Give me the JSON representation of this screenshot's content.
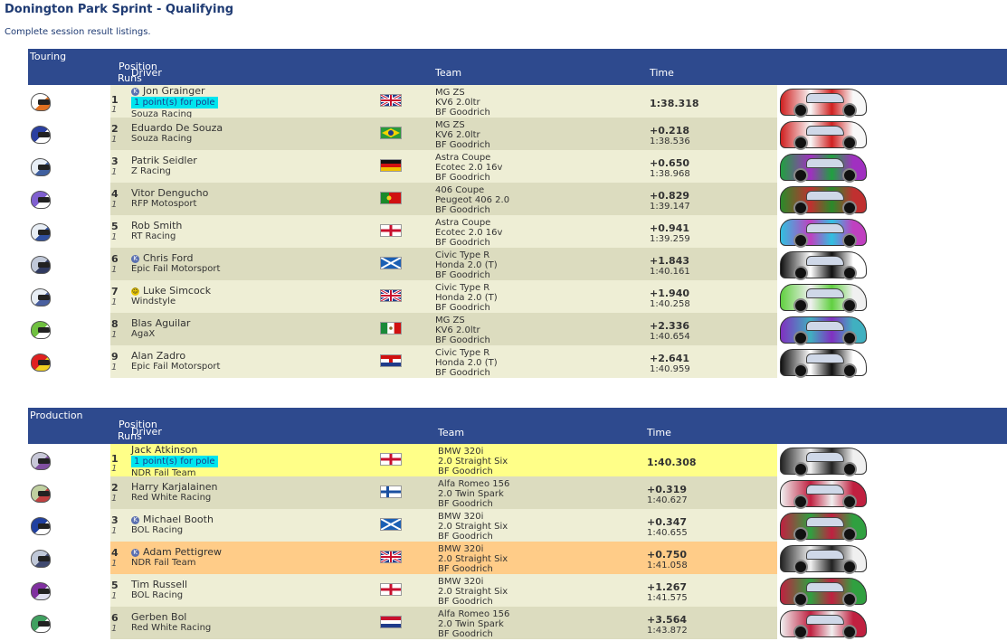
{
  "page": {
    "title": "Donington Park Sprint - Qualifying",
    "subtitle": "Complete session result listings."
  },
  "columns": {
    "position": "Position",
    "runs": "Runs",
    "driver": "Driver",
    "team": "Team",
    "time": "Time"
  },
  "sections": [
    {
      "class_name": "Touring",
      "rows": [
        {
          "pos": "1",
          "runs": "1",
          "driver": "Jon Grainger",
          "license": "K",
          "note": "1 point(s) for pole",
          "team_name": "Souza Racing",
          "car": "MG ZS",
          "engine": "KV6 2.0ltr",
          "tyres": "BF Goodrich",
          "gap": "1:38.318",
          "time": "",
          "flag": "uk",
          "helmet": "#ffffff",
          "helmet2": "#e07020",
          "car_color": "#d02020",
          "car_color2": "#f8f8f8"
        },
        {
          "pos": "2",
          "runs": "1",
          "driver": "Eduardo De Souza",
          "license": "",
          "note": "",
          "team_name": "Souza Racing",
          "car": "MG ZS",
          "engine": "KV6 2.0ltr",
          "tyres": "BF Goodrich",
          "gap": "+0.218",
          "time": "1:38.536",
          "flag": "brazil",
          "helmet": "#2a3fa0",
          "helmet2": "#ffffff",
          "car_color": "#d02020",
          "car_color2": "#f8f8f8"
        },
        {
          "pos": "3",
          "runs": "1",
          "driver": "Patrik Seidler",
          "license": "",
          "note": "",
          "team_name": "Z Racing",
          "car": "Astra Coupe",
          "engine": "Ecotec 2.0 16v",
          "tyres": "BF Goodrich",
          "gap": "+0.650",
          "time": "1:38.968",
          "flag": "germany",
          "helmet": "#e8eef5",
          "helmet2": "#4060a0",
          "car_color": "#20a040",
          "car_color2": "#a030c0"
        },
        {
          "pos": "4",
          "runs": "1",
          "driver": "Vitor Dengucho",
          "license": "",
          "note": "",
          "team_name": "RFP Motosport",
          "car": "406 Coupe",
          "engine": "Peugeot 406 2.0",
          "tyres": "BF Goodrich",
          "gap": "+0.829",
          "time": "1:39.147",
          "flag": "portugal",
          "helmet": "#8060d0",
          "helmet2": "#ffffff",
          "car_color": "#2a8a2a",
          "car_color2": "#c03030"
        },
        {
          "pos": "5",
          "runs": "1",
          "driver": "Rob Smith",
          "license": "",
          "note": "",
          "team_name": "RT Racing",
          "car": "Astra Coupe",
          "engine": "Ecotec 2.0 16v",
          "tyres": "BF Goodrich",
          "gap": "+0.941",
          "time": "1:39.259",
          "flag": "england",
          "helmet": "#e8eef5",
          "helmet2": "#3050a0",
          "car_color": "#30c0e0",
          "car_color2": "#c040c0"
        },
        {
          "pos": "6",
          "runs": "1",
          "driver": "Chris Ford",
          "license": "K",
          "note": "",
          "team_name": "Epic Fail Motorsport",
          "car": "Civic Type R",
          "engine": "Honda 2.0 (T)",
          "tyres": "BF Goodrich",
          "gap": "+1.843",
          "time": "1:40.161",
          "flag": "scotland",
          "helmet": "#c0c8d8",
          "helmet2": "#303a60",
          "car_color": "#111111",
          "car_color2": "#ffffff"
        },
        {
          "pos": "7",
          "runs": "1",
          "driver": "Luke Simcock",
          "license": "Y",
          "note": "",
          "team_name": "Windstyle",
          "car": "Civic Type R",
          "engine": "Honda 2.0 (T)",
          "tyres": "BF Goodrich",
          "gap": "+1.940",
          "time": "1:40.258",
          "flag": "uk",
          "helmet": "#e8eef5",
          "helmet2": "#4a60a0",
          "car_color": "#60d040",
          "car_color2": "#f0f0f0"
        },
        {
          "pos": "8",
          "runs": "1",
          "driver": "Blas Aguilar",
          "license": "",
          "note": "",
          "team_name": "AgaX",
          "car": "MG ZS",
          "engine": "KV6 2.0ltr",
          "tyres": "BF Goodrich",
          "gap": "+2.336",
          "time": "1:40.654",
          "flag": "mexico",
          "helmet": "#70c040",
          "helmet2": "#ffffff",
          "car_color": "#8030c0",
          "car_color2": "#40b0c0"
        },
        {
          "pos": "9",
          "runs": "1",
          "driver": "Alan Zadro",
          "license": "",
          "note": "",
          "team_name": "Epic Fail Motorsport",
          "car": "Civic Type R",
          "engine": "Honda 2.0 (T)",
          "tyres": "BF Goodrich",
          "gap": "+2.641",
          "time": "1:40.959",
          "flag": "croatia",
          "helmet": "#e02020",
          "helmet2": "#f0d020",
          "car_color": "#111111",
          "car_color2": "#ffffff"
        }
      ]
    },
    {
      "class_name": "Production",
      "rows": [
        {
          "pos": "1",
          "runs": "1",
          "driver": "Jack Atkinson",
          "license": "",
          "note": "1 point(s) for pole",
          "team_name": "NDR Fail Team",
          "car": "BMW 320i",
          "engine": "2.0 Straight Six",
          "tyres": "BF Goodrich",
          "gap": "1:40.308",
          "time": "",
          "flag": "england",
          "helmet": "#c8c8d8",
          "helmet2": "#8050a0",
          "car_color": "#222222",
          "car_color2": "#f0f0f0",
          "style": "pole"
        },
        {
          "pos": "2",
          "runs": "1",
          "driver": "Harry Karjalainen",
          "license": "",
          "note": "",
          "team_name": "Red White Racing",
          "car": "Alfa Romeo 156",
          "engine": "2.0 Twin Spark",
          "tyres": "BF Goodrich",
          "gap": "+0.319",
          "time": "1:40.627",
          "flag": "finland",
          "helmet": "#c0d0a0",
          "helmet2": "#c04040",
          "car_color": "#f0f0f0",
          "car_color2": "#c02040"
        },
        {
          "pos": "3",
          "runs": "1",
          "driver": "Michael Booth",
          "license": "K",
          "note": "",
          "team_name": "BOL Racing",
          "car": "BMW 320i",
          "engine": "2.0 Straight Six",
          "tyres": "BF Goodrich",
          "gap": "+0.347",
          "time": "1:40.655",
          "flag": "scotland",
          "helmet": "#2040a0",
          "helmet2": "#ffffff",
          "car_color": "#c02040",
          "car_color2": "#30a040"
        },
        {
          "pos": "4",
          "runs": "1",
          "driver": "Adam Pettigrew",
          "license": "K",
          "note": "",
          "team_name": "NDR Fail Team",
          "car": "BMW 320i",
          "engine": "2.0 Straight Six",
          "tyres": "BF Goodrich",
          "gap": "+0.750",
          "time": "1:41.058",
          "flag": "uk",
          "helmet": "#c0c8d8",
          "helmet2": "#404a70",
          "car_color": "#222222",
          "car_color2": "#f0f0f0",
          "style": "orange"
        },
        {
          "pos": "5",
          "runs": "1",
          "driver": "Tim Russell",
          "license": "",
          "note": "",
          "team_name": "BOL Racing",
          "car": "BMW 320i",
          "engine": "2.0 Straight Six",
          "tyres": "BF Goodrich",
          "gap": "+1.267",
          "time": "1:41.575",
          "flag": "england",
          "helmet": "#8030a0",
          "helmet2": "#e0e0f0",
          "car_color": "#c02040",
          "car_color2": "#30a040"
        },
        {
          "pos": "6",
          "runs": "1",
          "driver": "Gerben Bol",
          "license": "",
          "note": "",
          "team_name": "Red White Racing",
          "car": "Alfa Romeo 156",
          "engine": "2.0 Twin Spark",
          "tyres": "BF Goodrich",
          "gap": "+3.564",
          "time": "1:43.872",
          "flag": "netherlands",
          "helmet": "#40a060",
          "helmet2": "#ffffff",
          "car_color": "#f0f0f0",
          "car_color2": "#c02040"
        }
      ]
    }
  ]
}
